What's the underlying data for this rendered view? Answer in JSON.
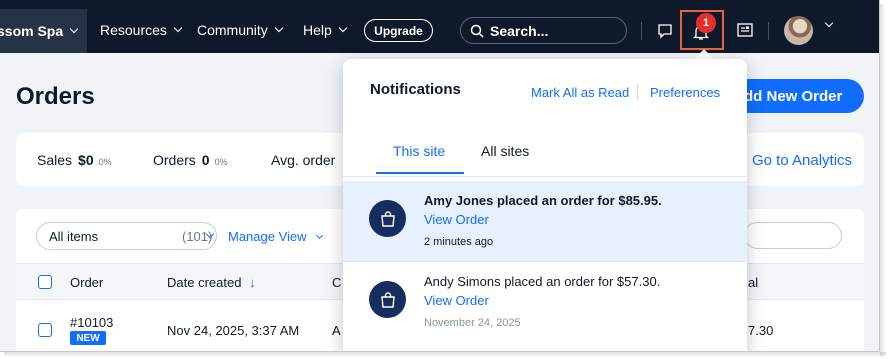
{
  "topbar": {
    "site_name": "ssom Spa",
    "nav": [
      "Resources",
      "Community",
      "Help"
    ],
    "upgrade_label": "Upgrade",
    "search_placeholder": "Search...",
    "notification_count": "1"
  },
  "page": {
    "title": "Orders",
    "add_order_label": "dd New Order",
    "stats": {
      "sales_label": "Sales",
      "sales_value": "$0",
      "sales_change": "0%",
      "orders_label": "Orders",
      "orders_value": "0",
      "orders_change": "0%",
      "avg_label": "Avg. order"
    },
    "analytics_label": "Go to Analytics",
    "filter": {
      "label": "All items",
      "count": "(101)"
    },
    "manage_view_label": "Manage View",
    "table": {
      "headers": {
        "order": "Order",
        "date": "Date created",
        "col3": "C",
        "total": "al"
      },
      "rows": [
        {
          "order": "#10103",
          "tag": "NEW",
          "date": "Nov 24, 2025, 3:37 AM",
          "col3": "A",
          "total": "7.30"
        }
      ]
    }
  },
  "notifications": {
    "title": "Notifications",
    "mark_all_read": "Mark All as Read",
    "preferences": "Preferences",
    "tabs": [
      "This site",
      "All sites"
    ],
    "items": [
      {
        "message": "Amy Jones placed an order for $85.95.",
        "link": "View Order",
        "time": "2 minutes ago"
      },
      {
        "message": "Andy Simons placed an order for $57.30.",
        "link": "View Order",
        "time": "November 24, 2025"
      }
    ]
  },
  "colors": {
    "accent": "#116dff",
    "topbar": "#0e1a2b",
    "highlight": "#e8623a",
    "unread_bg": "#e7f0ff"
  }
}
